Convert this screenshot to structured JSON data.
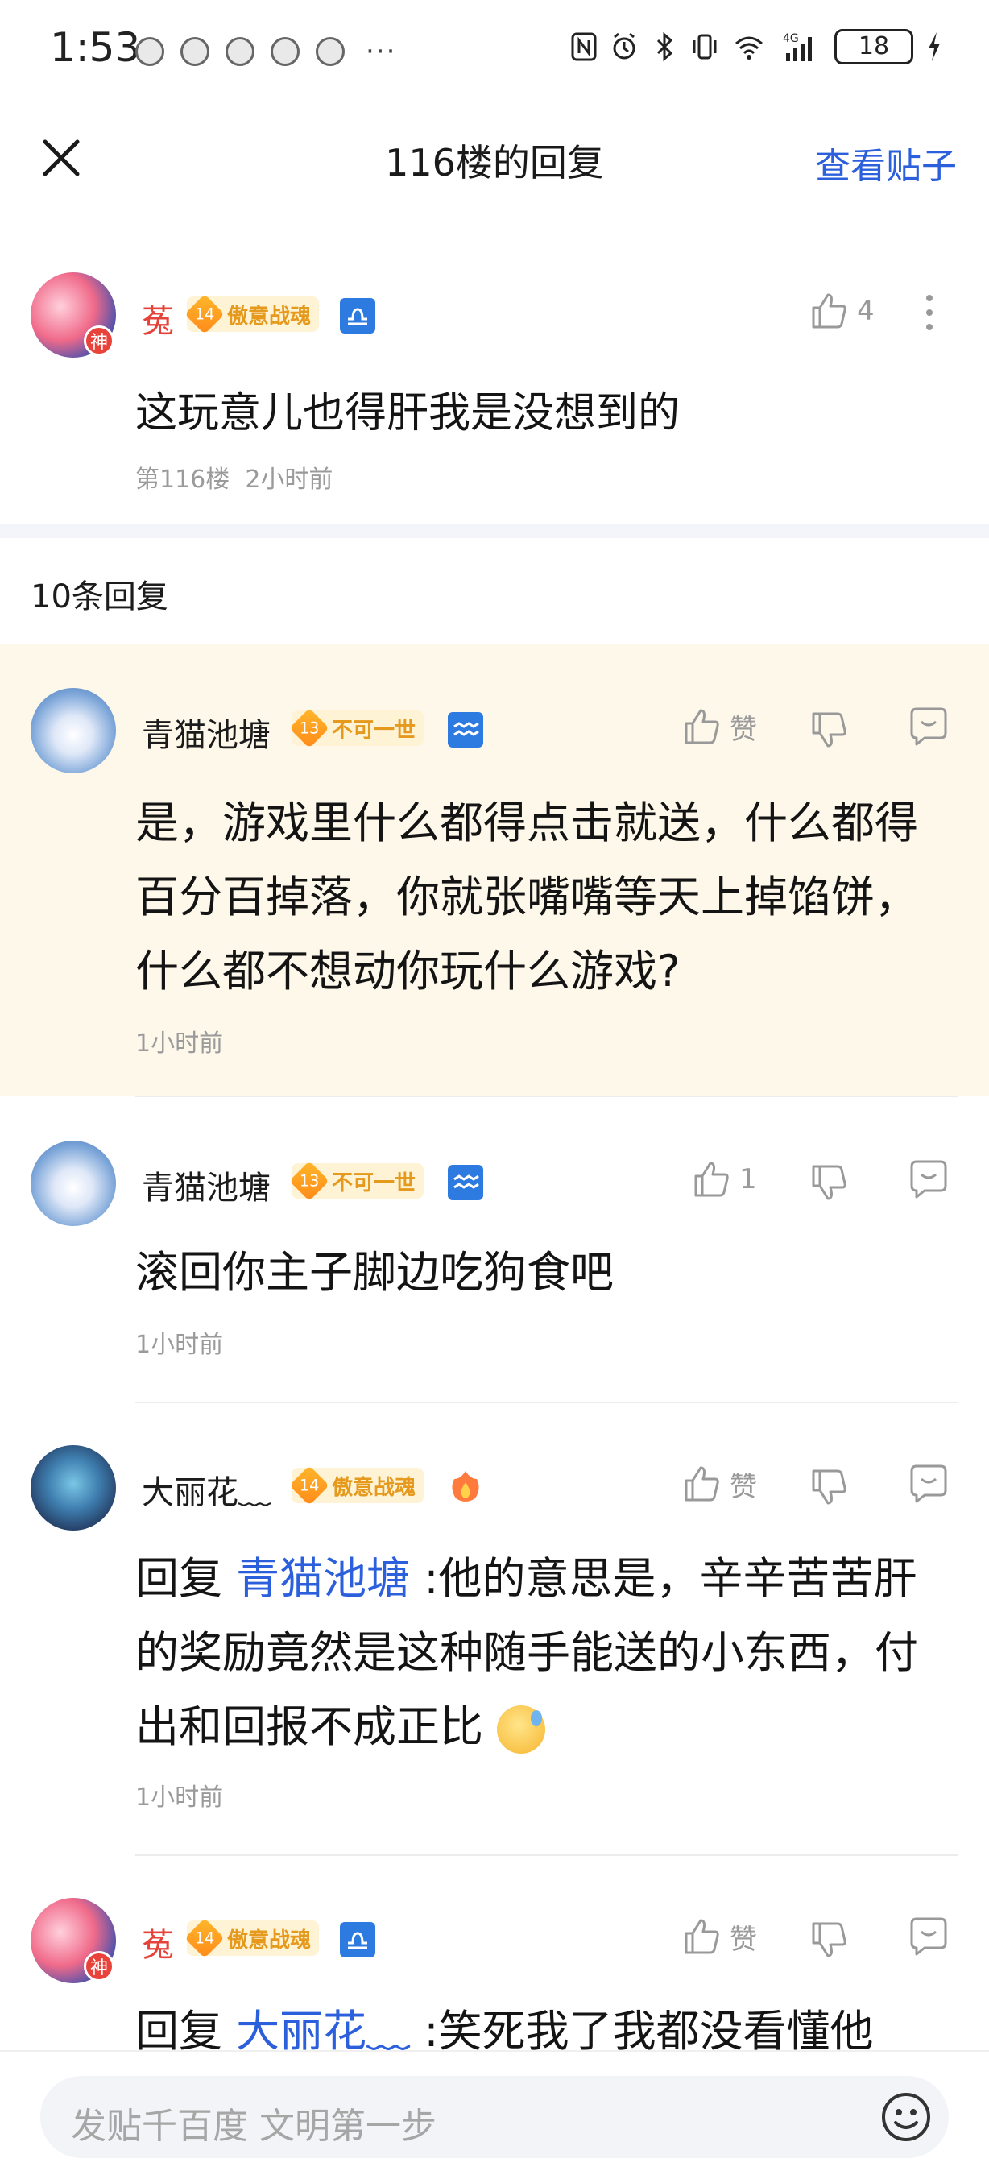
{
  "status_bar": {
    "time": "1:53",
    "more": "···",
    "battery": "18",
    "network": "4G"
  },
  "nav": {
    "title": "116楼的回复",
    "view_post": "查看贴子"
  },
  "main_post": {
    "username": "菟",
    "avatar_badge": "神",
    "level": "14",
    "level_title": "傲意战魂",
    "like_count": "4",
    "content": "这玩意儿也得肝我是没想到的",
    "floor": "第116楼",
    "time": "2小时前"
  },
  "reply_count": "10条回复",
  "replies": [
    {
      "username": "青猫池塘",
      "level": "13",
      "level_title": "不可一世",
      "like_label": "赞",
      "content": "是，游戏里什么都得点击就送，什么都得百分百掉落，你就张嘴嘴等天上掉馅饼，什么都不想动你玩什么游戏?",
      "time": "1小时前"
    },
    {
      "username": "青猫池塘",
      "level": "13",
      "level_title": "不可一世",
      "like_label": "1",
      "content": "滚回你主子脚边吃狗食吧",
      "time": "1小时前"
    },
    {
      "username": "大丽花﹏",
      "level": "14",
      "level_title": "傲意战魂",
      "like_label": "赞",
      "prefix": "回复",
      "mention": "青猫池塘",
      "content": ":他的意思是，辛辛苦苦肝的奖励竟然是这种随手能送的小东西，付出和回报不成正比",
      "time": "1小时前"
    },
    {
      "username": "菟",
      "avatar_badge": "神",
      "level": "14",
      "level_title": "傲意战魂",
      "like_label": "赞",
      "prefix": "回复",
      "mention": "大丽花﹏",
      "content": ":笑死我了我都没看懂他"
    }
  ],
  "compose": {
    "placeholder": "发贴千百度 文明第一步"
  },
  "colors": {
    "accent_blue": "#2b5fdb",
    "username_red": "#e5423a",
    "highlight_bg": "#fdf8ea",
    "level_gold": "#ffb72b"
  }
}
